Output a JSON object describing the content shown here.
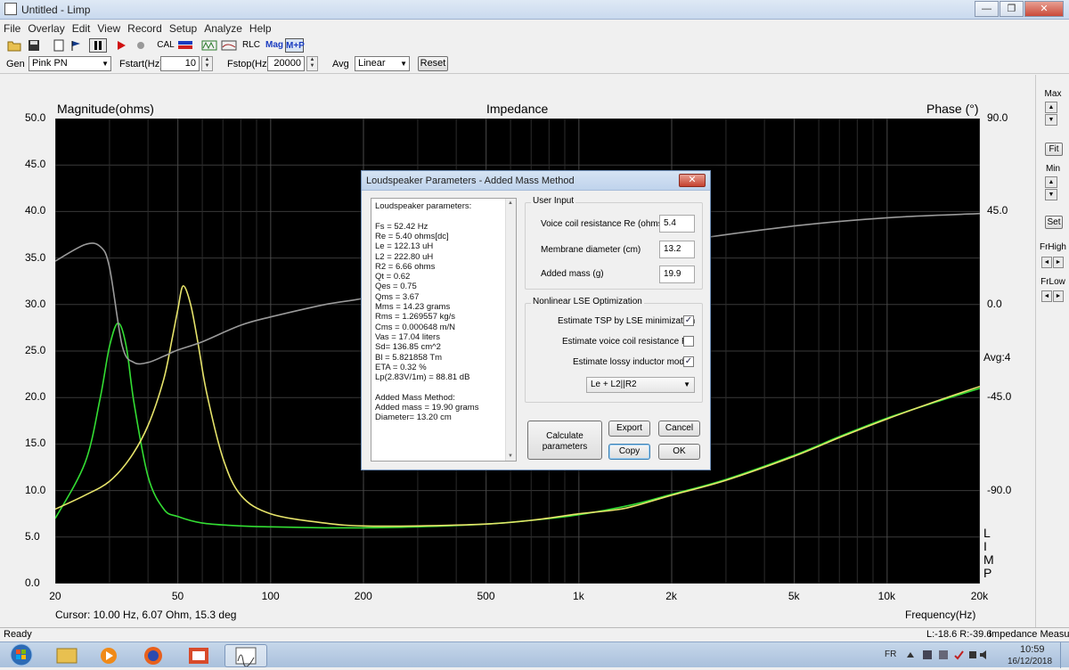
{
  "window": {
    "title": "Untitled - Limp",
    "minimize": "—",
    "maximize": "❐",
    "close": "✕"
  },
  "menu": [
    "File",
    "Overlay",
    "Edit",
    "View",
    "Record",
    "Setup",
    "Analyze",
    "Help"
  ],
  "toolbar": {
    "cal": "CAL",
    "rlc": "RLC",
    "mag": "Mag",
    "mp": "M+P"
  },
  "gen": {
    "gen_label": "Gen",
    "gen_value": "Pink PN",
    "fstart_label": "Fstart(Hz)",
    "fstart_value": "10",
    "fstop_label": "Fstop(Hz)",
    "fstop_value": "20000",
    "avg_label": "Avg",
    "avg_value": "Linear",
    "reset_label": "Reset"
  },
  "plot": {
    "left_title": "Magnitude(ohms)",
    "center_title": "Impedance",
    "right_title": "Phase (°)",
    "left_ticks": [
      "50.0",
      "45.0",
      "40.0",
      "35.0",
      "30.0",
      "25.0",
      "20.0",
      "15.0",
      "10.0",
      "5.0",
      "0.0"
    ],
    "right_ticks": [
      "90.0",
      "45.0",
      "0.0",
      "-45.0",
      "-90.0"
    ],
    "avg_label": "Avg:4",
    "x_ticks": [
      "20",
      "50",
      "100",
      "200",
      "500",
      "1k",
      "2k",
      "5k",
      "10k",
      "20k"
    ],
    "cursor": "Cursor: 10.00 Hz, 6.07 Ohm, 15.3 deg",
    "x_title": "Frequency(Hz)",
    "side_letters": [
      "L",
      "I",
      "M",
      "P"
    ]
  },
  "chart_data": {
    "type": "line",
    "title": "Impedance",
    "xlabel": "Frequency(Hz)",
    "ylabel": "Magnitude(ohms)",
    "y2label": "Phase (°)",
    "xscale": "log",
    "xlim": [
      20,
      20000
    ],
    "ylim": [
      0,
      50
    ],
    "y2lim": [
      -135,
      90
    ],
    "grid": true,
    "series": [
      {
        "color": "#33dd33",
        "x": [
          20,
          25,
          28,
          30,
          32,
          34,
          36,
          40,
          45,
          50,
          60,
          80,
          100,
          150,
          200,
          300,
          500,
          700,
          1000,
          1500,
          2000,
          3000,
          5000,
          7000,
          10000,
          15000,
          20000
        ],
        "y": [
          7.0,
          13.0,
          20.0,
          25.5,
          28.0,
          25.5,
          19.5,
          11.5,
          8.0,
          7.2,
          6.5,
          6.2,
          6.1,
          6.0,
          6.0,
          6.1,
          6.4,
          6.8,
          7.4,
          8.5,
          9.6,
          11.2,
          13.8,
          15.8,
          17.8,
          19.7,
          21.0
        ]
      },
      {
        "color": "#e6e36a",
        "x": [
          20,
          25,
          30,
          35,
          40,
          45,
          48,
          50,
          52,
          55,
          58,
          62,
          70,
          80,
          100,
          150,
          200,
          300,
          500,
          700,
          1000,
          1300,
          1500,
          2000,
          3000,
          5000,
          7000,
          10000,
          15000,
          20000
        ],
        "y": [
          8.0,
          9.5,
          11.0,
          13.5,
          17.0,
          22.0,
          26.5,
          29.5,
          32.0,
          30.0,
          26.0,
          20.5,
          13.5,
          9.5,
          7.5,
          6.5,
          6.2,
          6.2,
          6.4,
          6.8,
          7.5,
          7.9,
          8.3,
          9.5,
          11.1,
          13.7,
          15.7,
          17.7,
          19.8,
          21.2
        ]
      },
      {
        "color": "#9a9a9a",
        "axis": "phase",
        "x": [
          20,
          25,
          28,
          30,
          33,
          36,
          40,
          45,
          50,
          60,
          80,
          100,
          150,
          200,
          300,
          500,
          1000,
          2000,
          5000,
          10000,
          20000
        ],
        "y": [
          21,
          29,
          28,
          18,
          -20,
          -28,
          -28,
          -25,
          -22,
          -18,
          -10,
          -6,
          0,
          3,
          9,
          15,
          22,
          30,
          38,
          42,
          44
        ]
      }
    ]
  },
  "right_panel": {
    "max": "Max",
    "fit": "Fit",
    "min": "Min",
    "set": "Set",
    "frhigh": "FrHigh",
    "frlow": "FrLow"
  },
  "status": {
    "ready": "Ready",
    "levels": "L:-18.6 R:-39.6",
    "mode": "Impedance Measur"
  },
  "taskbar": {
    "lang": "FR",
    "time": "10:59",
    "date": "16/12/2018"
  },
  "dialog": {
    "title": "Loudspeaker Parameters - Added Mass Method",
    "close": "✕",
    "params": [
      "Loudspeaker parameters:",
      "",
      "Fs  = 52.42 Hz",
      "Re  = 5.40 ohms[dc]",
      "Le  = 122.13 uH",
      "L2  = 222.80 uH",
      "R2  = 6.66 ohms",
      "Qt  = 0.62",
      "Qes = 0.75",
      "Qms = 3.67",
      "Mms = 14.23 grams",
      "Rms = 1.269557 kg/s",
      "Cms = 0.000648 m/N",
      "Vas = 17.04 liters",
      "Sd= 136.85 cm^2",
      "Bl  = 5.821858 Tm",
      "ETA = 0.32 %",
      "Lp(2.83V/1m) = 88.81 dB",
      "",
      "Added Mass Method:",
      "Added mass = 19.90 grams",
      "Diameter= 13.20 cm"
    ],
    "user_input_title": "User Input",
    "re_label": "Voice coil resistance Re (ohms)",
    "re_value": "5.4",
    "diam_label": "Membrane diameter (cm)",
    "diam_value": "13.2",
    "mass_label": "Added mass (g)",
    "mass_value": "19.9",
    "lse_title": "Nonlinear LSE Optimization",
    "chk1_label": "Estimate TSP by LSE minimization",
    "chk1": "✓",
    "chk2_label": "Estimate voice coil resistance Re",
    "chk2": "",
    "chk3_label": "Estimate lossy inductor model",
    "chk3": "✓",
    "model_value": "Le + L2||R2",
    "calc_label_1": "Calculate",
    "calc_label_2": "parameters",
    "export": "Export",
    "cancel": "Cancel",
    "copy": "Copy",
    "ok": "OK"
  }
}
